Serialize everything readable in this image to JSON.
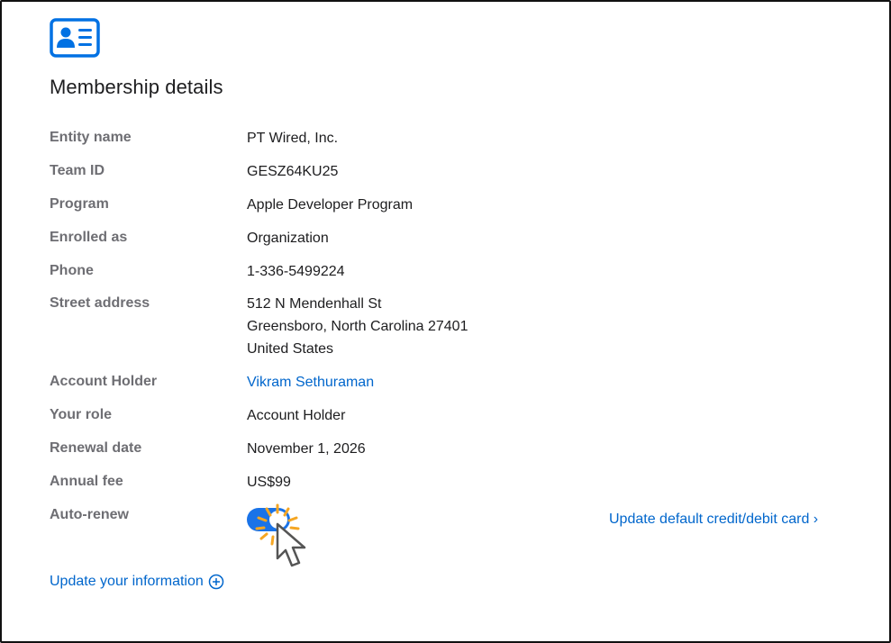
{
  "title": "Membership details",
  "icon": "contact-card-icon",
  "accent_color": "#0066cc",
  "rows": [
    {
      "label": "Entity name",
      "value": "PT Wired, Inc."
    },
    {
      "label": "Team ID",
      "value": "GESZ64KU25"
    },
    {
      "label": "Program",
      "value": "Apple Developer Program"
    },
    {
      "label": "Enrolled as",
      "value": "Organization"
    },
    {
      "label": "Phone",
      "value": "1-336-5499224"
    }
  ],
  "address": {
    "label": "Street address",
    "lines": [
      "512 N Mendenhall St",
      "Greensboro, North Carolina 27401",
      "United States"
    ]
  },
  "account_holder": {
    "label": "Account Holder",
    "value": "Vikram Sethuraman"
  },
  "rows2": [
    {
      "label": "Your role",
      "value": "Account Holder"
    },
    {
      "label": "Renewal date",
      "value": "November 1, 2026"
    },
    {
      "label": "Annual fee",
      "value": "US$99"
    }
  ],
  "auto_renew": {
    "label": "Auto-renew",
    "enabled": true
  },
  "update_card_link": "Update default credit/debit card ›",
  "update_info_link": "Update your information"
}
